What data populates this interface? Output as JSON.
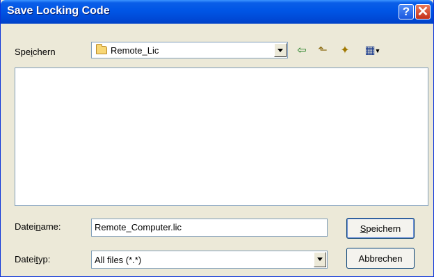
{
  "window": {
    "title": "Save Locking Code",
    "help_label": "?",
    "close_label": "✕"
  },
  "location": {
    "label_pre": "Spe",
    "label_acc": "i",
    "label_post": "chern",
    "current_folder": "Remote_Lic"
  },
  "toolbar": {
    "back_icon": "⇦",
    "up_icon": "⬑",
    "new_folder_icon": "✦",
    "view_icon": "▦"
  },
  "filename": {
    "label_pre": "Datei",
    "label_acc": "n",
    "label_post": "ame:",
    "value": "Remote_Computer.lic"
  },
  "filetype": {
    "label_pre": "Datei",
    "label_acc": "t",
    "label_post": "yp:",
    "value": "All files (*.*)"
  },
  "buttons": {
    "save": {
      "acc": "S",
      "rest": "peichern"
    },
    "cancel_label": "Abbrechen"
  }
}
